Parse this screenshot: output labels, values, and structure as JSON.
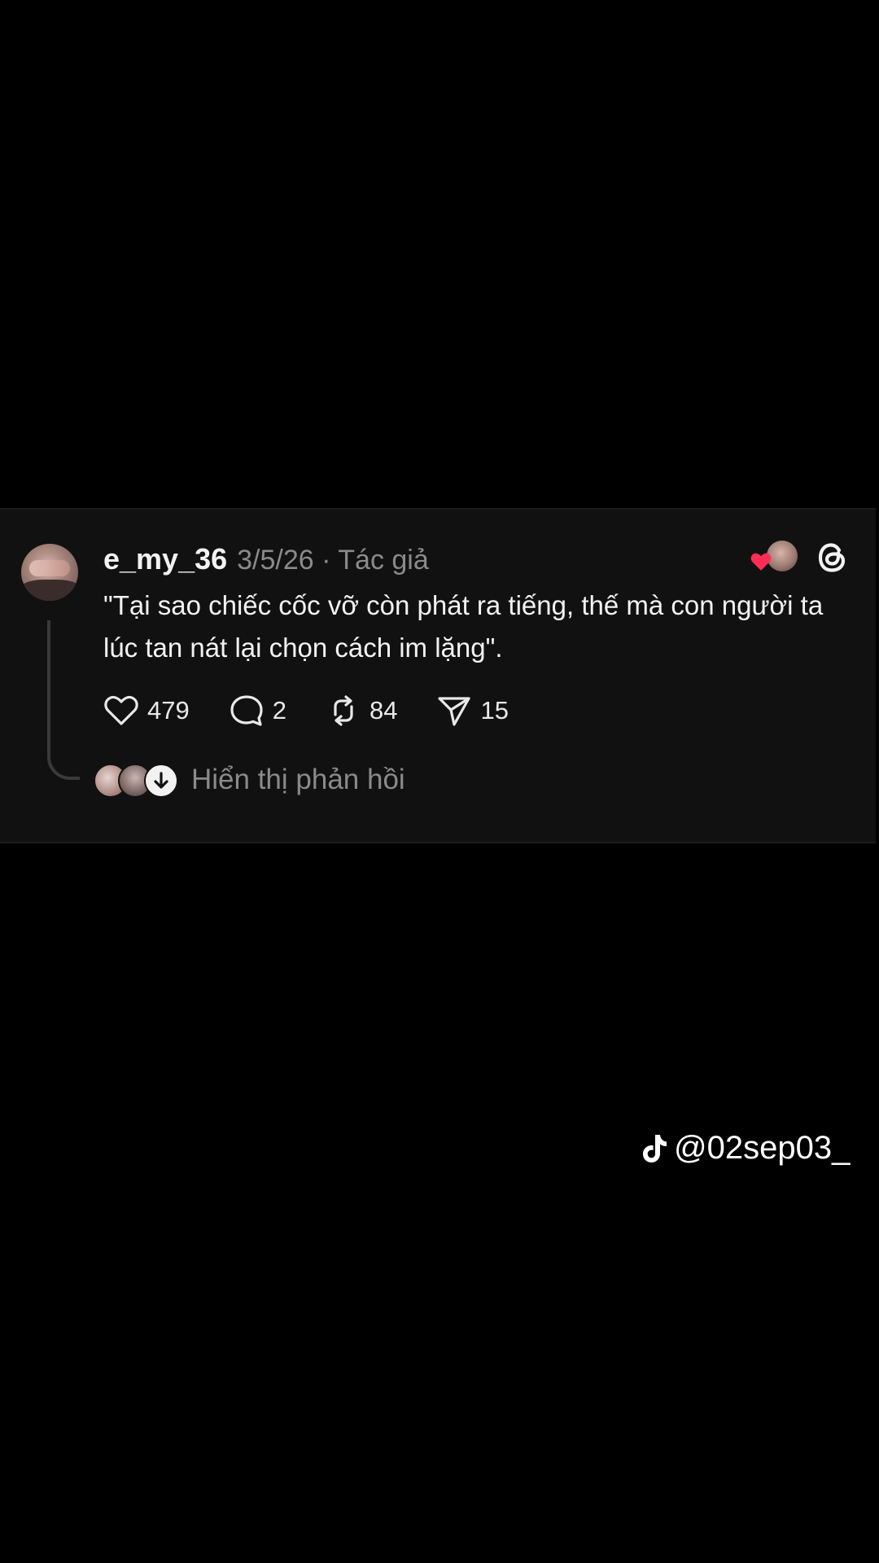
{
  "post": {
    "username": "e_my_36",
    "meta": "3/5/26 · Tác giả",
    "text": "\"Tại sao chiếc cốc vỡ còn phát ra tiếng, thế mà con người ta lúc tan nát lại chọn cách im lặng\".",
    "actions": {
      "likes": "479",
      "comments": "2",
      "reposts": "84",
      "shares": "15"
    },
    "show_replies_label": "Hiển thị phản hồi",
    "heart_color": "#ff2d55"
  },
  "icons": {
    "like": "heart-outline-icon",
    "comment": "speech-bubble-icon",
    "repost": "repost-arrows-icon",
    "share": "paper-plane-icon",
    "app": "threads-logo-icon",
    "watermark": "tiktok-logo-icon"
  },
  "watermark": {
    "handle": "@02sep03_"
  }
}
